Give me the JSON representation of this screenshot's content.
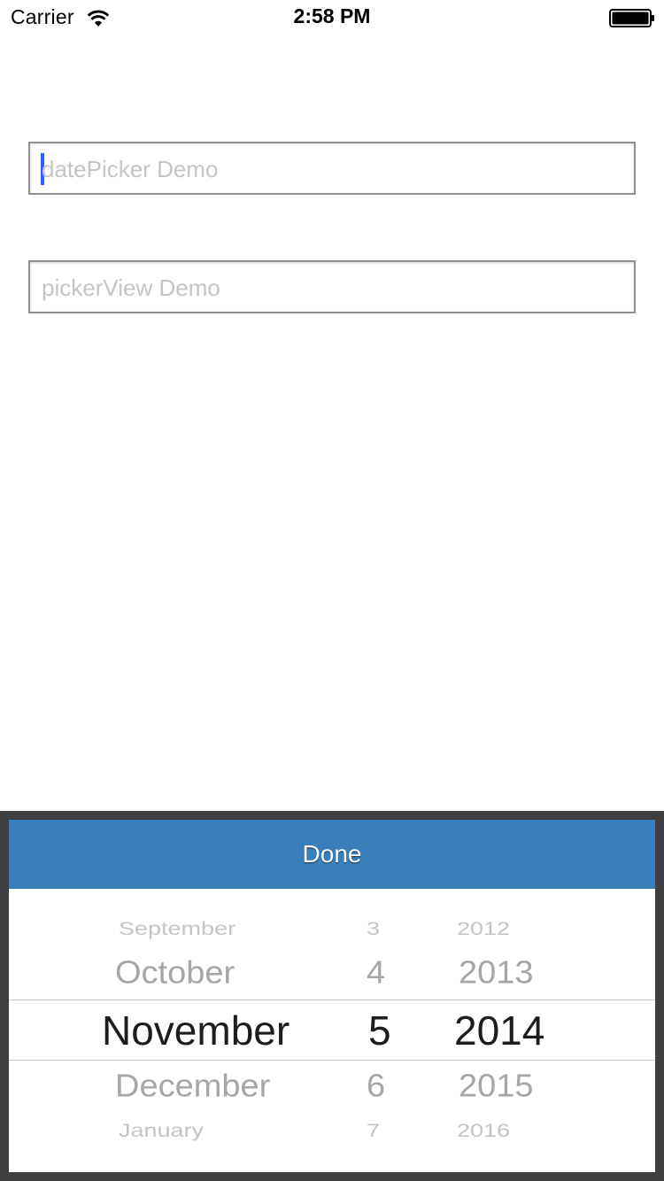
{
  "status_bar": {
    "carrier": "Carrier",
    "time": "2:58 PM",
    "wifi_icon": "wifi-icon",
    "battery_icon": "battery-icon"
  },
  "fields": {
    "date_picker": {
      "value": "",
      "placeholder": "datePicker Demo",
      "focused": true
    },
    "picker_view": {
      "value": "",
      "placeholder": "pickerView Demo",
      "focused": false
    }
  },
  "toolbar": {
    "done_label": "Done",
    "bar_color": "#387fbc"
  },
  "date_picker": {
    "months": [
      "September",
      "October",
      "November",
      "December",
      "January"
    ],
    "days": [
      "3",
      "4",
      "5",
      "6",
      "7"
    ],
    "years": [
      "2012",
      "2013",
      "2014",
      "2015",
      "2016"
    ],
    "selected": {
      "month": "November",
      "day": "5",
      "year": "2014"
    }
  },
  "colors": {
    "caret": "#2c5ff5",
    "panel_bg": "#3e3f41"
  }
}
